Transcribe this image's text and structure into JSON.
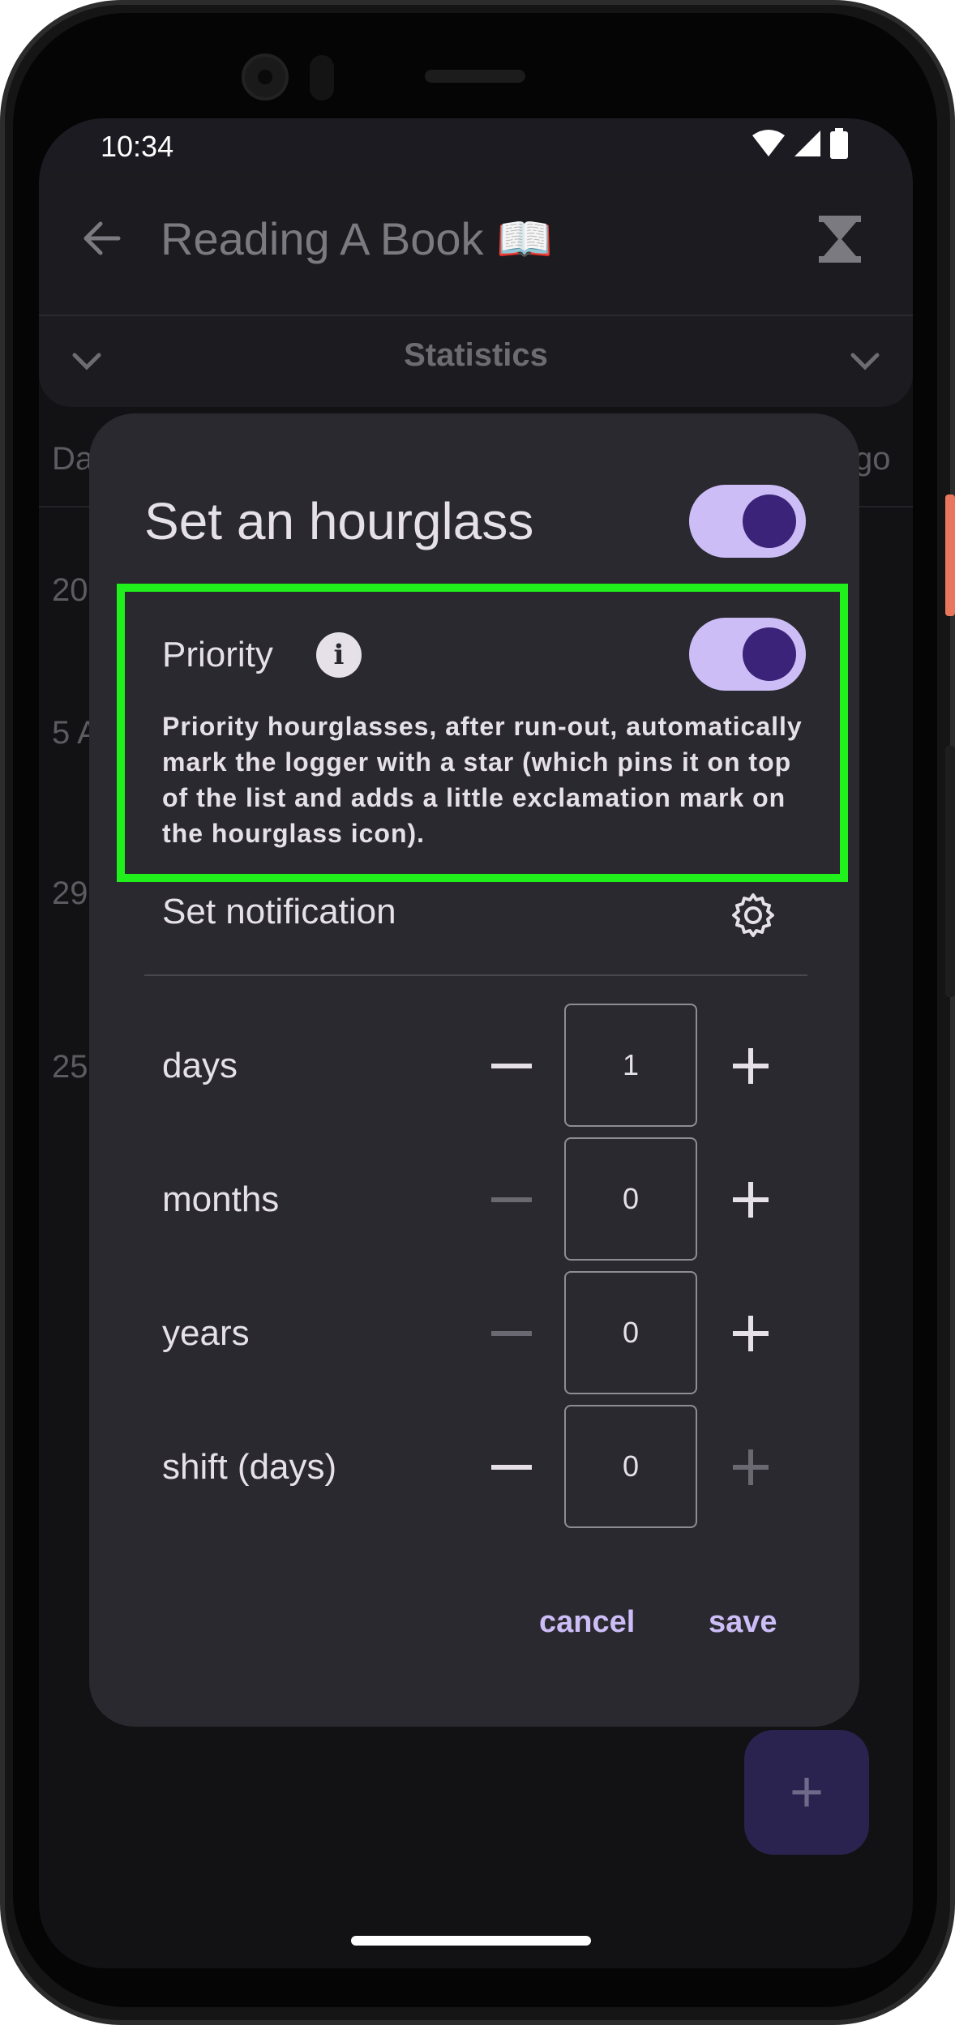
{
  "status_bar": {
    "time": "10:34"
  },
  "app_bar": {
    "title": "Reading A Book 📖",
    "section_label": "Statistics"
  },
  "background_list": {
    "header_left": "Da",
    "header_right": "go",
    "rows": [
      "20",
      "5 A",
      "29",
      "25"
    ]
  },
  "dialog": {
    "title": "Set an hourglass",
    "hourglass_enabled": true,
    "priority": {
      "label": "Priority",
      "enabled": true,
      "description": "Priority hourglasses, after run-out, automatically mark the logger with a star (which pins it on top of the list and adds a little exclamation mark on the hourglass icon)."
    },
    "notification_label": "Set notification",
    "steppers": [
      {
        "label": "days",
        "value": "1",
        "minus_enabled": true,
        "plus_enabled": true
      },
      {
        "label": "months",
        "value": "0",
        "minus_enabled": false,
        "plus_enabled": true
      },
      {
        "label": "years",
        "value": "0",
        "minus_enabled": false,
        "plus_enabled": true
      },
      {
        "label": "shift (days)",
        "value": "0",
        "minus_enabled": true,
        "plus_enabled": false
      }
    ],
    "cancel_label": "cancel",
    "save_label": "save"
  },
  "fab": {
    "symbol": "+"
  },
  "colors": {
    "accent": "#cdbdf7",
    "toggle_knob": "#3a2378",
    "highlight": "#20f01c",
    "dialog_bg": "#2a292f",
    "fab_bg": "#2a2350"
  },
  "icons": [
    "back-arrow-icon",
    "hourglass-icon",
    "chevron-down-icon",
    "info-icon",
    "gear-icon",
    "wifi-icon",
    "signal-icon",
    "battery-icon",
    "plus-icon",
    "minus-icon"
  ]
}
